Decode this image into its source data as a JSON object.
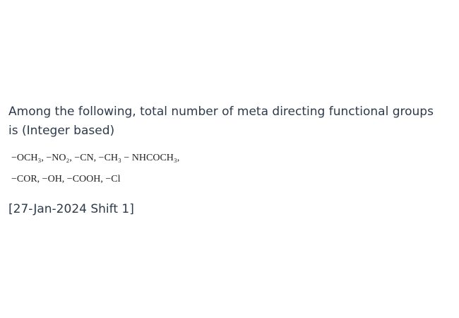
{
  "question": {
    "text": "Among the following, total number of meta directing functional groups is (Integer based)"
  },
  "formulas": {
    "line1": "−OCH₃, −NO₂, −CN, −CH₃ − NHCOCH₃,",
    "line2": "−COR, −OH, −COOH, −Cl"
  },
  "source": {
    "text": "[27-Jan-2024 Shift 1]"
  }
}
